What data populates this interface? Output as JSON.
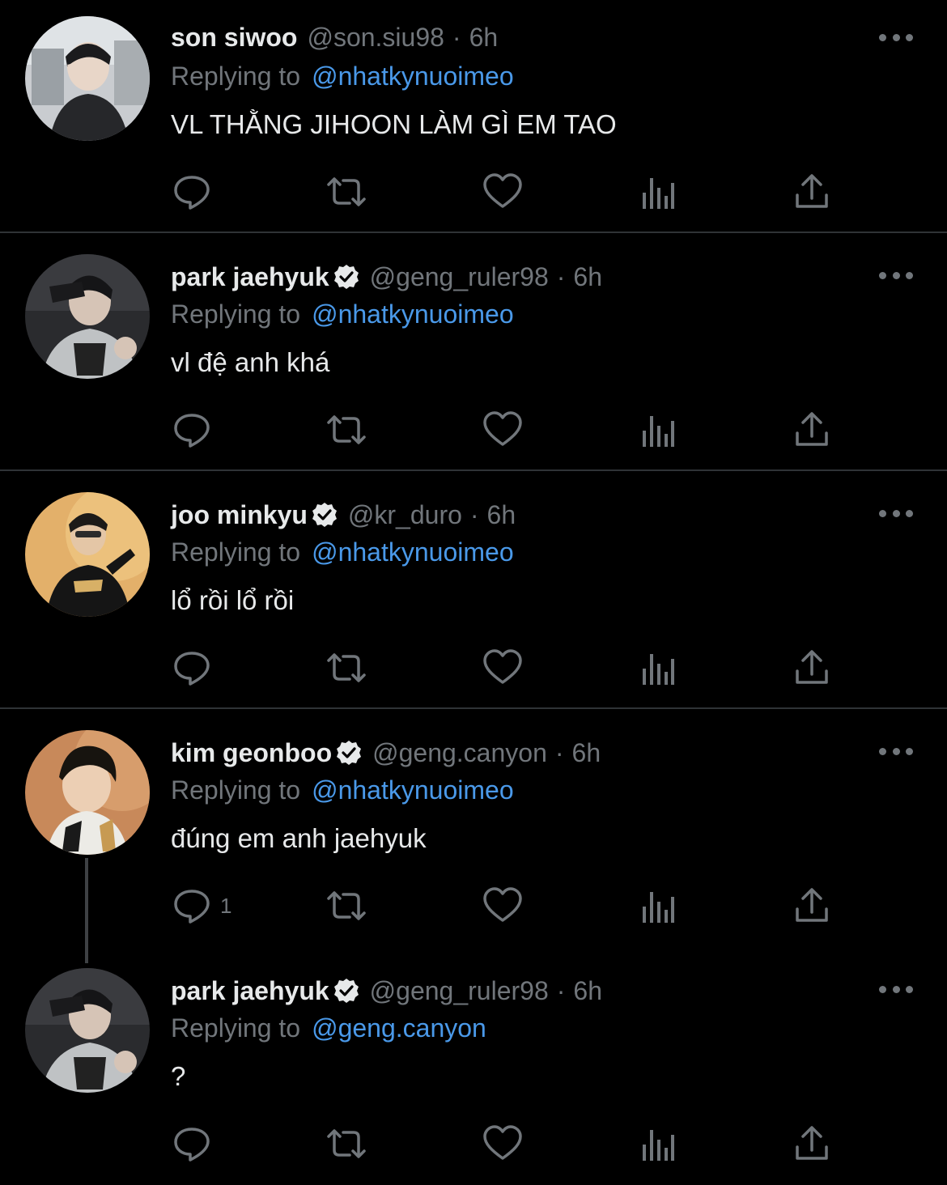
{
  "tweets": [
    {
      "display_name": "son siwoo",
      "verified": false,
      "handle": "@son.siu98",
      "separator": "·",
      "time": "6h",
      "replying_prefix": "Replying to",
      "replying_to": "@nhatkynuoimeo",
      "text": "VL THẰNG JIHOON LÀM GÌ EM TAO",
      "reply_count": ""
    },
    {
      "display_name": "park jaehyuk",
      "verified": true,
      "handle": "@geng_ruler98",
      "separator": "·",
      "time": "6h",
      "replying_prefix": "Replying to",
      "replying_to": "@nhatkynuoimeo",
      "text": "vl đệ anh khá",
      "reply_count": ""
    },
    {
      "display_name": "joo minkyu",
      "verified": true,
      "handle": "@kr_duro",
      "separator": "·",
      "time": "6h",
      "replying_prefix": "Replying to",
      "replying_to": "@nhatkynuoimeo",
      "text": "lổ rồi lổ rồi",
      "reply_count": ""
    },
    {
      "display_name": "kim geonboo",
      "verified": true,
      "handle": "@geng.canyon",
      "separator": "·",
      "time": "6h",
      "replying_prefix": "Replying to",
      "replying_to": "@nhatkynuoimeo",
      "text": "đúng em anh jaehyuk",
      "reply_count": "1"
    },
    {
      "display_name": "park jaehyuk",
      "verified": true,
      "handle": "@geng_ruler98",
      "separator": "·",
      "time": "6h",
      "replying_prefix": "Replying to",
      "replying_to": "@geng.canyon",
      "text": "?",
      "reply_count": ""
    }
  ],
  "icons": {
    "reply": "reply-icon",
    "retweet": "retweet-icon",
    "like": "like-icon",
    "views": "views-icon",
    "share": "share-icon",
    "more": "more-icon",
    "verified": "verified-badge-icon"
  },
  "colors": {
    "background": "#000000",
    "text": "#e7e9ea",
    "muted": "#71767b",
    "link": "#4a99e9",
    "divider": "#2f3336"
  }
}
